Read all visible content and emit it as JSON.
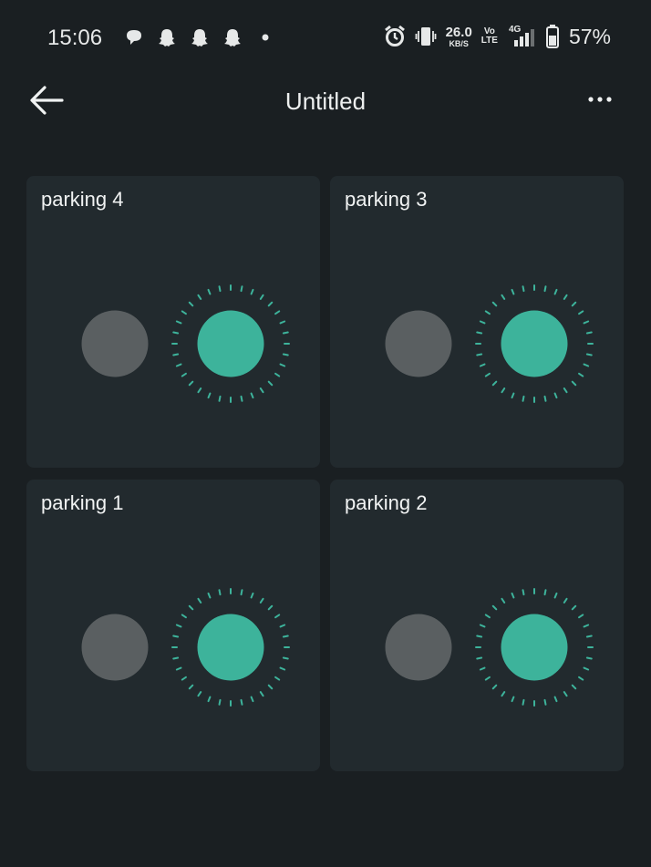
{
  "status_bar": {
    "time": "15:06",
    "left_icons": [
      "chat-bubble-icon",
      "snapchat-ghost-icon",
      "snapchat-ghost-icon",
      "snapchat-ghost-icon",
      "dot-icon"
    ],
    "net_speed_value": "26.0",
    "net_speed_unit": "KB/S",
    "volte_line1": "Vo",
    "volte_line2": "LTE",
    "network_type": "4G",
    "battery_percent": "57%"
  },
  "app_bar": {
    "title": "Untitled",
    "back_icon": "arrow-left-icon",
    "more_icon": "more-horizontal-icon"
  },
  "cards": [
    {
      "title": "parking 4",
      "state": "on"
    },
    {
      "title": "parking 3",
      "state": "on"
    },
    {
      "title": "parking 1",
      "state": "on"
    },
    {
      "title": "parking 2",
      "state": "on"
    }
  ],
  "colors": {
    "background": "#1a1f22",
    "card": "#222a2e",
    "inactive_circle": "#5a5f61",
    "active_circle": "#3db39b",
    "text": "#eef0f0"
  }
}
